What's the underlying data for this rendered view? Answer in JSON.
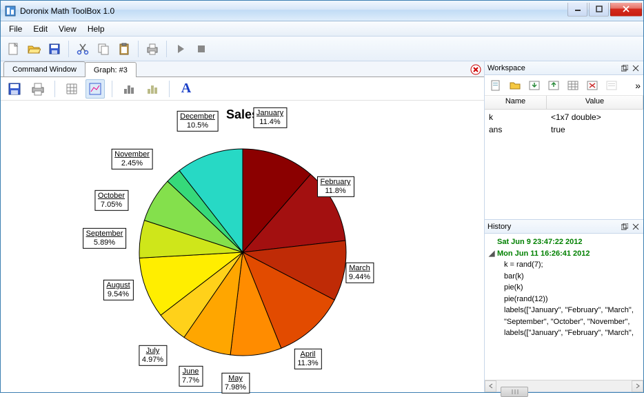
{
  "window": {
    "title": "Doronix Math ToolBox 1.0"
  },
  "menu": {
    "file": "File",
    "edit": "Edit",
    "view": "View",
    "help": "Help"
  },
  "tabs": {
    "command": "Command Window",
    "graph": "Graph: #3"
  },
  "chart_data": {
    "type": "pie",
    "title": "Sales",
    "categories": [
      "January",
      "February",
      "March",
      "April",
      "May",
      "June",
      "July",
      "August",
      "September",
      "October",
      "November",
      "December"
    ],
    "values": [
      11.4,
      11.8,
      9.44,
      11.3,
      7.98,
      7.7,
      4.97,
      9.54,
      5.89,
      7.05,
      2.45,
      10.5
    ],
    "colors": [
      "#8b0000",
      "#a31010",
      "#bf2b06",
      "#e24b00",
      "#ff8c00",
      "#ffa600",
      "#ffd11a",
      "#ffee00",
      "#cfe61a",
      "#84e04c",
      "#36d97a",
      "#27d9c5"
    ]
  },
  "workspace": {
    "title": "Workspace",
    "columns": {
      "name": "Name",
      "value": "Value"
    },
    "rows": [
      {
        "name": "k",
        "value": "<1x7 double>"
      },
      {
        "name": "ans",
        "value": "true"
      }
    ]
  },
  "history": {
    "title": "History",
    "sessions": [
      {
        "label": "Sat Jun 9 23:47:22 2012",
        "expanded": false,
        "commands": []
      },
      {
        "label": "Mon Jun 11 16:26:41 2012",
        "expanded": true,
        "commands": [
          "k = rand(7);",
          "bar(k)",
          "pie(k)",
          "pie(rand(12))",
          "labels([\"January\", \"February\", \"March\",",
          "\"September\", \"October\", \"November\",",
          "labels([\"January\", \"February\", \"March\","
        ]
      }
    ]
  }
}
